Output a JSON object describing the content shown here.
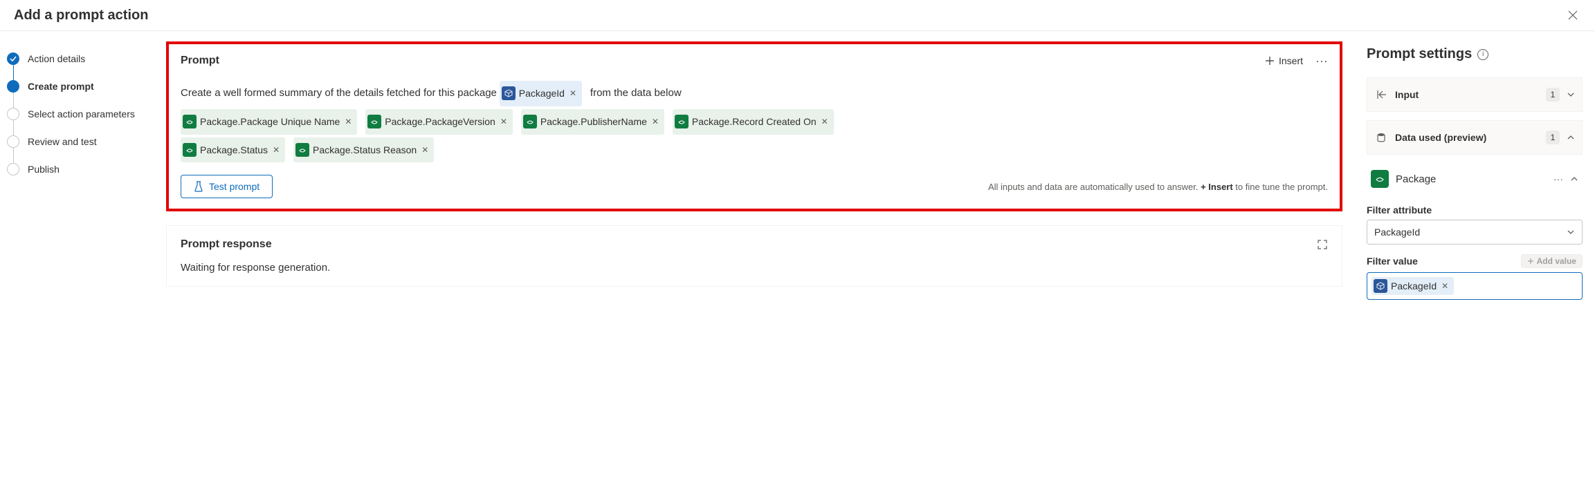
{
  "header": {
    "title": "Add a prompt action"
  },
  "steps": [
    {
      "label": "Action details",
      "state": "completed"
    },
    {
      "label": "Create prompt",
      "state": "current"
    },
    {
      "label": "Select action parameters",
      "state": "pending"
    },
    {
      "label": "Review and test",
      "state": "pending"
    },
    {
      "label": "Publish",
      "state": "pending"
    }
  ],
  "prompt": {
    "heading": "Prompt",
    "insert_label": "Insert",
    "text_before": "Create a well formed summary of the details fetched for this package",
    "inline_chip": {
      "label": "PackageId"
    },
    "text_after": "from the data below",
    "chips": [
      {
        "label": "Package.Package Unique Name"
      },
      {
        "label": "Package.PackageVersion"
      },
      {
        "label": "Package.PublisherName"
      },
      {
        "label": "Package.Record Created On"
      },
      {
        "label": "Package.Status"
      },
      {
        "label": "Package.Status Reason"
      }
    ],
    "test_label": "Test prompt",
    "hint_before": "All inputs and data are automatically used to answer. ",
    "hint_strong": "+ Insert",
    "hint_after": " to fine tune the prompt."
  },
  "response": {
    "heading": "Prompt response",
    "body": "Waiting for response generation."
  },
  "settings": {
    "title": "Prompt settings",
    "sections": {
      "input": {
        "label": "Input",
        "count": "1"
      },
      "data_used": {
        "label": "Data used (preview)",
        "count": "1"
      }
    },
    "data_entry": {
      "label": "Package"
    },
    "filter_attribute": {
      "label": "Filter attribute",
      "value": "PackageId"
    },
    "filter_value": {
      "label": "Filter value",
      "add_label": "Add value",
      "chip": "PackageId"
    }
  }
}
